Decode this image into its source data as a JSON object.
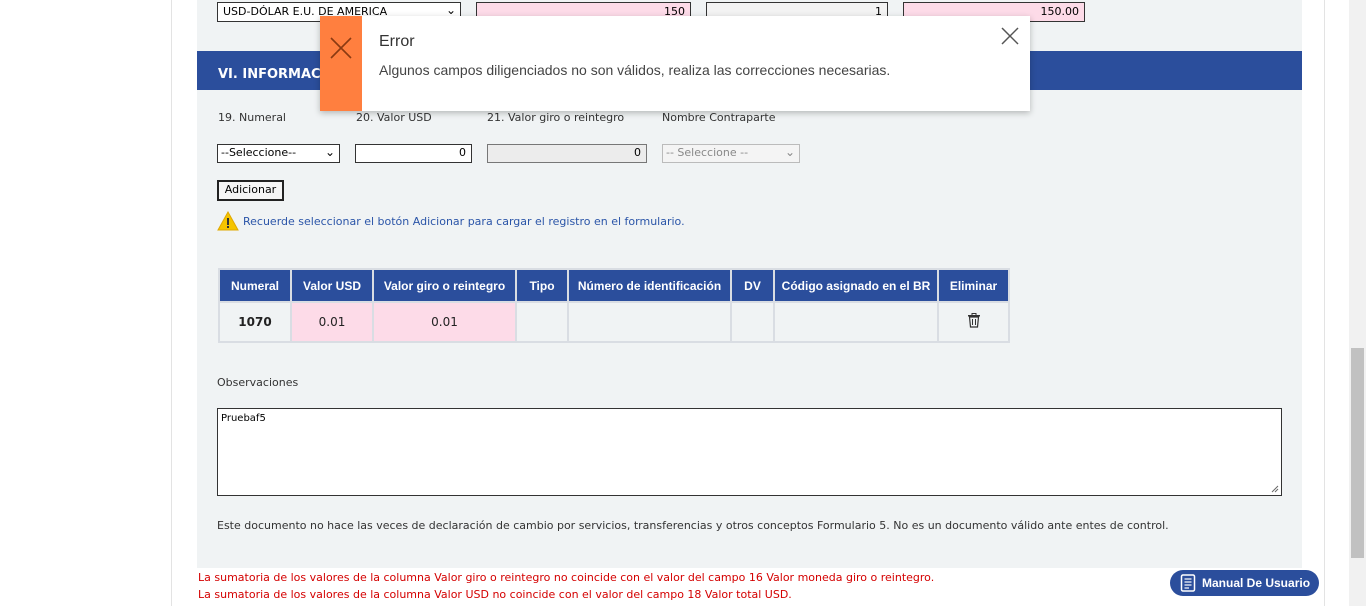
{
  "top_row": {
    "currency_value": "USD-DÓLAR E.U. DE AMERICA",
    "amount": "150",
    "rate": "1",
    "total": "150.00"
  },
  "section": {
    "title": "VI. INFORMACIÓN"
  },
  "form": {
    "numeral_label": "19. Numeral",
    "valor_usd_label": "20. Valor USD",
    "valor_giro_label": "21. Valor giro o reintegro",
    "contraparte_label": "Nombre Contraparte",
    "numeral_select": "--Seleccione--",
    "valor_usd_value": "0",
    "valor_giro_value": "0",
    "contraparte_select": "-- Seleccione --",
    "add_button": "Adicionar",
    "warning": "Recuerde seleccionar el botón Adicionar para cargar el registro en el formulario."
  },
  "table": {
    "headers": [
      "Numeral",
      "Valor USD",
      "Valor giro o reintegro",
      "Tipo",
      "Número de identificación",
      "DV",
      "Código asignado en el BR",
      "Eliminar"
    ],
    "rows": [
      {
        "numeral": "1070",
        "valor_usd": "0.01",
        "valor_giro": "0.01",
        "tipo": "",
        "numero_id": "",
        "dv": "",
        "codigo_br": ""
      }
    ]
  },
  "observaciones": {
    "label": "Observaciones",
    "value": "Pruebaf5"
  },
  "disclaimer": "Este documento no hace las veces de declaración de cambio por servicios, transferencias y otros conceptos Formulario 5. No es un documento válido ante entes de control.",
  "errors": [
    "La sumatoria de los valores de la columna Valor giro o reintegro no coincide con el valor del campo 16 Valor moneda giro o reintegro.",
    "La sumatoria de los valores de la columna Valor USD no coincide con el valor del campo 18 Valor total USD."
  ],
  "manual_button": "Manual De Usuario",
  "toast": {
    "title": "Error",
    "message": "Algunos campos diligenciados no son válidos, realiza las correcciones necesarias."
  },
  "colors": {
    "header_blue": "#2b4e9c",
    "error_red": "#d40000",
    "toast_orange": "#ff7f3f",
    "pink_field": "#fddbe8"
  }
}
